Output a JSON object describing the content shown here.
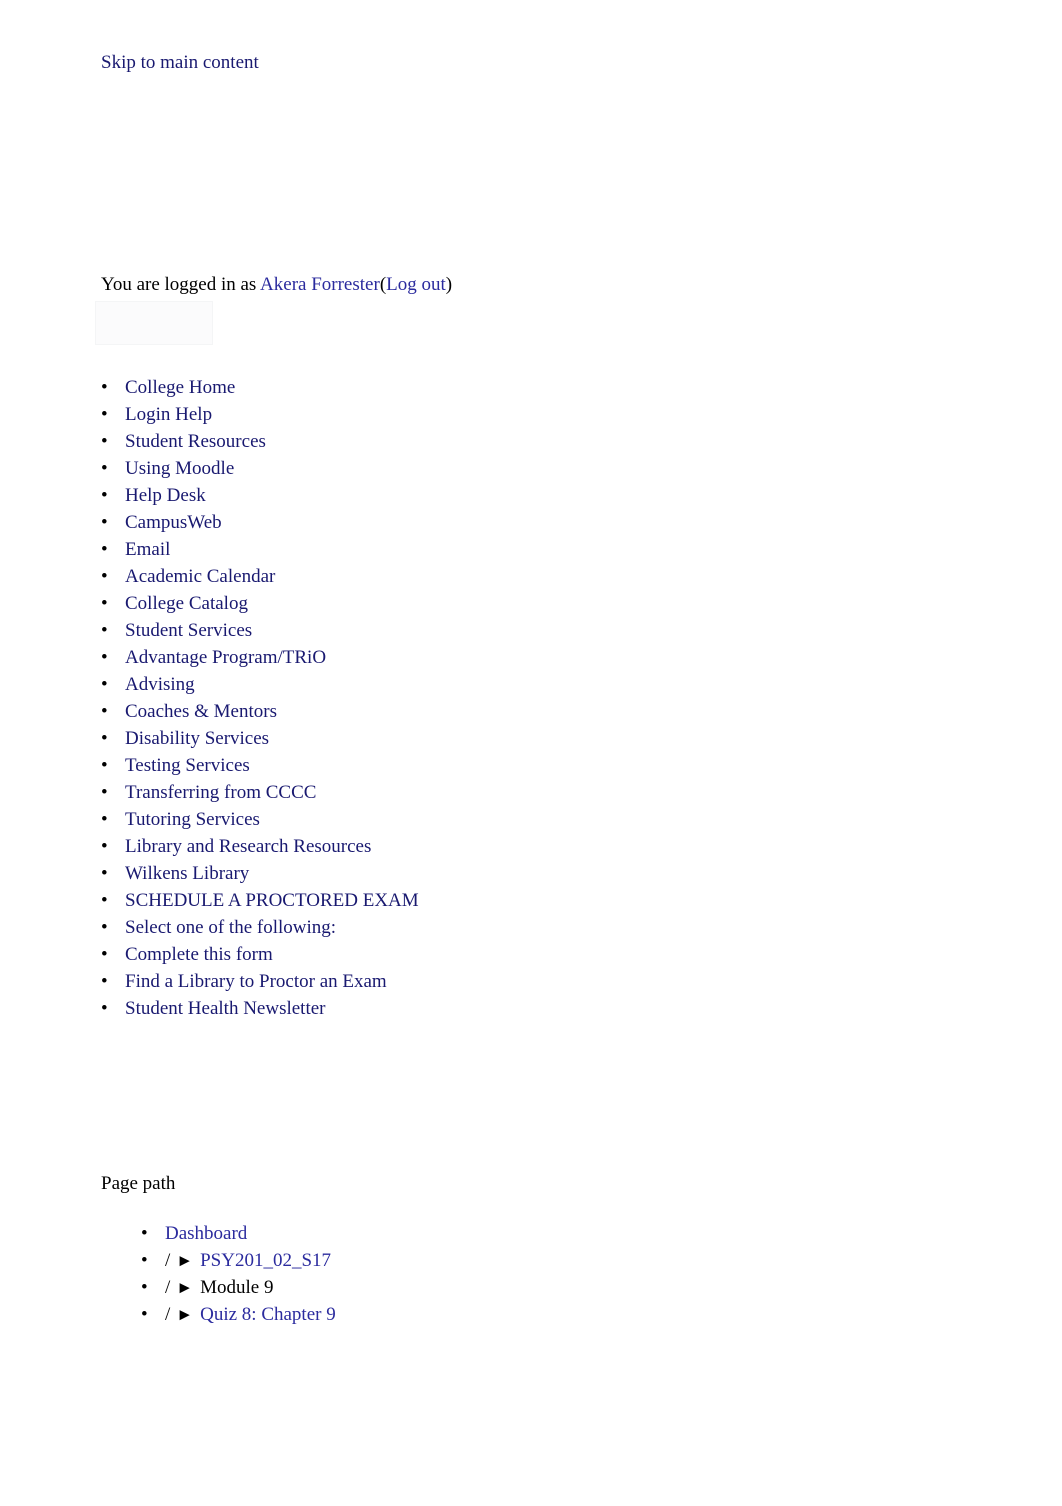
{
  "accessibility": {
    "skip_link": "Skip to main content"
  },
  "user_bar": {
    "prefix": "You are logged in as ",
    "user_name": "Akera Forrester",
    "open_paren": "(",
    "logout_label": "Log out",
    "close_paren": ")"
  },
  "colors": {
    "link": "#191970",
    "link_alt": "#2b2b9e",
    "text": "#000000",
    "background": "#ffffff"
  },
  "nav": {
    "bullet_glyph": "•",
    "items": [
      {
        "label": "College Home",
        "level": 1
      },
      {
        "label": "Login Help",
        "level": 1
      },
      {
        "label": "Student Resources",
        "level": 1
      },
      {
        "label": "Using Moodle",
        "level": 2
      },
      {
        "label": "Help Desk",
        "level": 2
      },
      {
        "label": "CampusWeb",
        "level": 2
      },
      {
        "label": "Email",
        "level": 2
      },
      {
        "label": "Academic Calendar",
        "level": 2
      },
      {
        "label": "College Catalog",
        "level": 2
      },
      {
        "label": "Student Services",
        "level": 1
      },
      {
        "label": "Advantage Program/TRiO",
        "level": 2
      },
      {
        "label": "Advising",
        "level": 2
      },
      {
        "label": "Coaches & Mentors",
        "level": 2
      },
      {
        "label": "Disability Services",
        "level": 2
      },
      {
        "label": "Testing Services",
        "level": 2
      },
      {
        "label": "Transferring from CCCC",
        "level": 2
      },
      {
        "label": "Tutoring Services",
        "level": 2
      },
      {
        "label": "Library and Research Resources",
        "level": 1
      },
      {
        "label": "Wilkens Library",
        "level": 2
      },
      {
        "label": "SCHEDULE A PROCTORED EXAM",
        "level": 1
      },
      {
        "label": "Select one of the following:",
        "level": 2
      },
      {
        "label": "Complete this form",
        "level": 3
      },
      {
        "label": "Find a Library to Proctor an Exam",
        "level": 3
      },
      {
        "label": "Student Health Newsletter",
        "level": 1
      }
    ]
  },
  "page_path": {
    "heading": "Page path",
    "bullet_glyph": "•",
    "separator": "/",
    "arrow": "►",
    "crumbs": [
      {
        "label": "Dashboard",
        "is_link": true,
        "has_separator": false
      },
      {
        "label": "PSY201_02_S17",
        "is_link": true,
        "has_separator": true
      },
      {
        "label": "Module 9",
        "is_link": false,
        "has_separator": true
      },
      {
        "label": "Quiz 8: Chapter 9",
        "is_link": true,
        "has_separator": true
      }
    ]
  }
}
